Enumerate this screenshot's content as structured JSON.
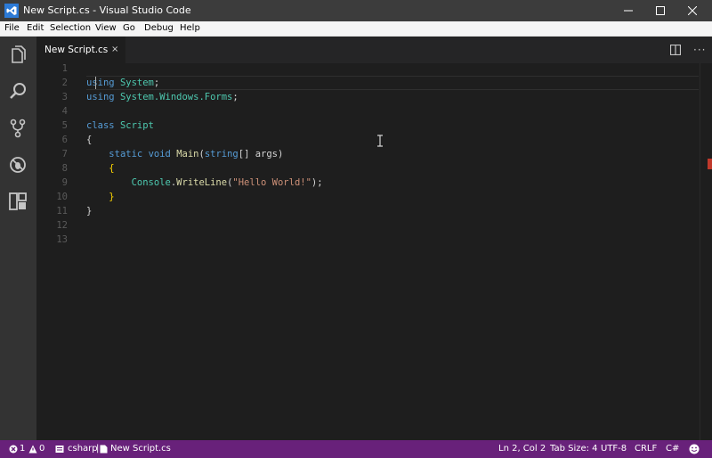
{
  "window": {
    "title": "New Script.cs - Visual Studio Code"
  },
  "menu": [
    "File",
    "Edit",
    "Selection",
    "View",
    "Go",
    "Debug",
    "Help"
  ],
  "activity": [
    "explorer-icon",
    "search-icon",
    "git-icon",
    "debug-icon",
    "extensions-icon"
  ],
  "tab": {
    "label": "New Script.cs",
    "close": "×"
  },
  "editor": {
    "line_numbers": [
      "1",
      "2",
      "3",
      "4",
      "5",
      "6",
      "7",
      "8",
      "9",
      "10",
      "11",
      "12",
      "13"
    ],
    "lines": [
      [],
      [
        {
          "t": "kw",
          "v": "using"
        },
        {
          "t": "tx",
          "v": " "
        },
        {
          "t": "ty",
          "v": "System"
        },
        {
          "t": "tx",
          "v": ";"
        }
      ],
      [
        {
          "t": "kw",
          "v": "using"
        },
        {
          "t": "tx",
          "v": " "
        },
        {
          "t": "ty",
          "v": "System.Windows.Forms"
        },
        {
          "t": "tx",
          "v": ";"
        }
      ],
      [],
      [
        {
          "t": "kw",
          "v": "class"
        },
        {
          "t": "tx",
          "v": " "
        },
        {
          "t": "ty",
          "v": "Script"
        }
      ],
      [
        {
          "t": "tx",
          "v": "{"
        }
      ],
      [
        {
          "t": "tx",
          "v": "    "
        },
        {
          "t": "kw",
          "v": "static"
        },
        {
          "t": "tx",
          "v": " "
        },
        {
          "t": "kw",
          "v": "void"
        },
        {
          "t": "tx",
          "v": " "
        },
        {
          "t": "fn",
          "v": "Main"
        },
        {
          "t": "tx",
          "v": "("
        },
        {
          "t": "kw",
          "v": "string"
        },
        {
          "t": "tx",
          "v": "[] args)"
        }
      ],
      [
        {
          "t": "tx",
          "v": "    "
        },
        {
          "t": "br",
          "v": "{"
        }
      ],
      [
        {
          "t": "tx",
          "v": "        "
        },
        {
          "t": "ty",
          "v": "Console"
        },
        {
          "t": "tx",
          "v": "."
        },
        {
          "t": "fn",
          "v": "WriteLine"
        },
        {
          "t": "tx",
          "v": "("
        },
        {
          "t": "st",
          "v": "\"Hello World!\""
        },
        {
          "t": "tx",
          "v": ");"
        }
      ],
      [
        {
          "t": "tx",
          "v": "    "
        },
        {
          "t": "br",
          "v": "}"
        }
      ],
      [
        {
          "t": "tx",
          "v": "}"
        }
      ],
      [],
      []
    ]
  },
  "status": {
    "errors": "1",
    "warnings": "0",
    "language_project": "csharp",
    "separator": "|",
    "file": "New Script.cs",
    "position": "Ln 2, Col 2",
    "tab_size": "Tab Size: 4",
    "encoding": "UTF-8",
    "eol": "CRLF",
    "language": "C#"
  },
  "colors": {
    "status_bar": "#68217a",
    "activity_bar": "#333333",
    "editor_bg": "#1e1e1e",
    "keyword": "#569cd6",
    "type": "#4ec9b0",
    "string": "#ce9178"
  }
}
